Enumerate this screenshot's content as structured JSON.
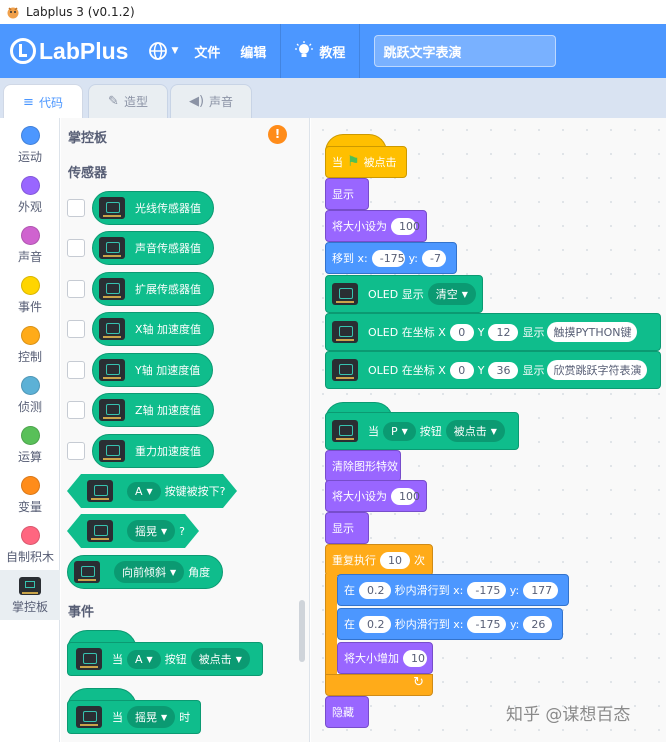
{
  "window": {
    "title": "Labplus 3 (v0.1.2)"
  },
  "menubar": {
    "logo": "LabPlus",
    "file": "文件",
    "edit": "编辑",
    "tutorial": "教程",
    "project_title": "跳跃文字表演"
  },
  "tabs": [
    {
      "label": "代码"
    },
    {
      "label": "造型"
    },
    {
      "label": "声音"
    }
  ],
  "categories": [
    {
      "label": "运动",
      "color": "#4c97ff"
    },
    {
      "label": "外观",
      "color": "#9966ff"
    },
    {
      "label": "声音",
      "color": "#cf63cf"
    },
    {
      "label": "事件",
      "color": "#ffd500"
    },
    {
      "label": "控制",
      "color": "#ffab19"
    },
    {
      "label": "侦测",
      "color": "#5cb1d6"
    },
    {
      "label": "运算",
      "color": "#59c059"
    },
    {
      "label": "变量",
      "color": "#ff8c1a"
    },
    {
      "label": "自制积木",
      "color": "#ff6680"
    },
    {
      "label": "掌控板",
      "color": ""
    }
  ],
  "palette": {
    "title": "掌控板",
    "warning": "!",
    "section_sensor": "传感器",
    "section_event": "事件",
    "sensor_blocks": [
      "光线传感器值",
      "声音传感器值",
      "扩展传感器值",
      "X轴 加速度值",
      "Y轴 加速度值",
      "Z轴 加速度值",
      "重力加速度值"
    ],
    "button_pressed": {
      "button": "A",
      "text": "按键被按下?"
    },
    "shake": {
      "option": "摇晃",
      "suffix": "?"
    },
    "tilt": {
      "option": "向前倾斜",
      "suffix": "角度"
    },
    "event1": {
      "when": "当",
      "button": "A",
      "mid": "按钮",
      "action": "被点击"
    },
    "event2": {
      "when": "当",
      "option": "摇晃",
      "suffix": "时"
    }
  },
  "script1": {
    "hat": {
      "when": "当",
      "clicked": "被点击"
    },
    "show": "显示",
    "setsize": {
      "label": "将大小设为",
      "value": "100"
    },
    "goto": {
      "label": "移到 x:",
      "x": "-175",
      "ylabel": "y:",
      "y": "-7"
    },
    "oled_show": {
      "label": "OLED 显示",
      "option": "清空"
    },
    "oled_text1": {
      "label": "OLED 在坐标 X",
      "x": "0",
      "ylabel": "Y",
      "y": "12",
      "show": "显示",
      "text": "触摸PYTHON键"
    },
    "oled_text2": {
      "label": "OLED 在坐标 X",
      "x": "0",
      "ylabel": "Y",
      "y": "36",
      "show": "显示",
      "text": "欣赏跳跃字符表演"
    }
  },
  "script2": {
    "hat": {
      "when": "当",
      "button": "P",
      "mid": "按钮",
      "action": "被点击"
    },
    "clear": "清除图形特效",
    "setsize": {
      "label": "将大小设为",
      "value": "100"
    },
    "show": "显示",
    "repeat": {
      "label": "重复执行",
      "times": "10",
      "suffix": "次"
    },
    "glide1": {
      "in": "在",
      "secs": "0.2",
      "mid": "秒内滑行到 x:",
      "x": "-175",
      "ylabel": "y:",
      "y": "177"
    },
    "glide2": {
      "in": "在",
      "secs": "0.2",
      "mid": "秒内滑行到 x:",
      "x": "-175",
      "ylabel": "y:",
      "y": "26"
    },
    "changesize": {
      "label": "将大小增加",
      "value": "10"
    },
    "hide": "隐藏"
  },
  "watermark": "知乎 @谋想百态"
}
